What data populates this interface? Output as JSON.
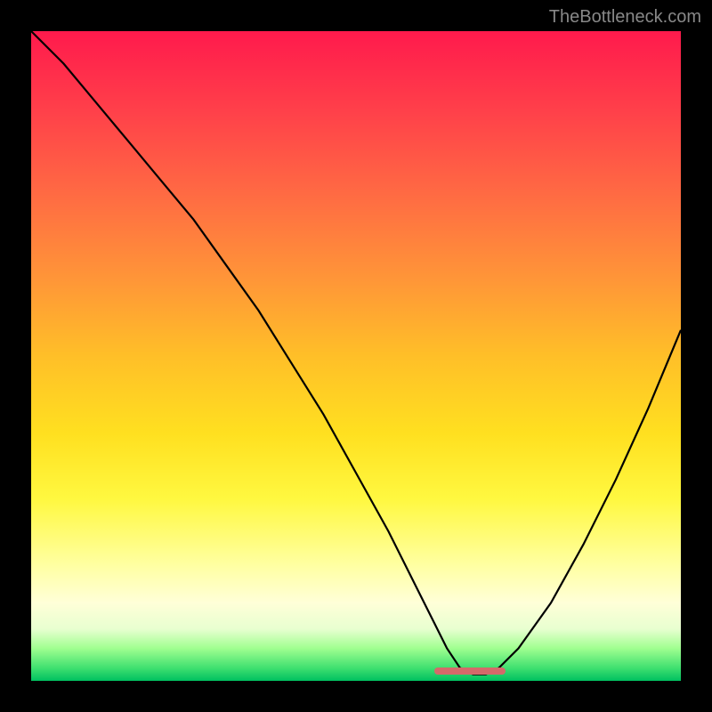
{
  "watermark": "TheBottleneck.com",
  "chart_data": {
    "type": "line",
    "title": "",
    "xlabel": "",
    "ylabel": "",
    "xlim": [
      0,
      100
    ],
    "ylim": [
      0,
      100
    ],
    "series": [
      {
        "name": "bottleneck-curve",
        "x": [
          0,
          5,
          10,
          15,
          20,
          25,
          30,
          35,
          40,
          45,
          50,
          55,
          60,
          62,
          64,
          66,
          68,
          70,
          72,
          75,
          80,
          85,
          90,
          95,
          100
        ],
        "values": [
          100,
          95,
          89,
          83,
          77,
          71,
          64,
          57,
          49,
          41,
          32,
          23,
          13,
          9,
          5,
          2,
          1,
          1,
          2,
          5,
          12,
          21,
          31,
          42,
          54
        ]
      }
    ],
    "annotations": [
      {
        "type": "segment",
        "x0": 62,
        "x1": 73,
        "y": 1.5,
        "color": "#d46a6a",
        "name": "optimal-range"
      }
    ],
    "gradient_background": {
      "top": "#ff1a4c",
      "mid": "#ffe020",
      "bottom": "#00c060",
      "meaning": "red=high bottleneck, green=balanced"
    }
  }
}
